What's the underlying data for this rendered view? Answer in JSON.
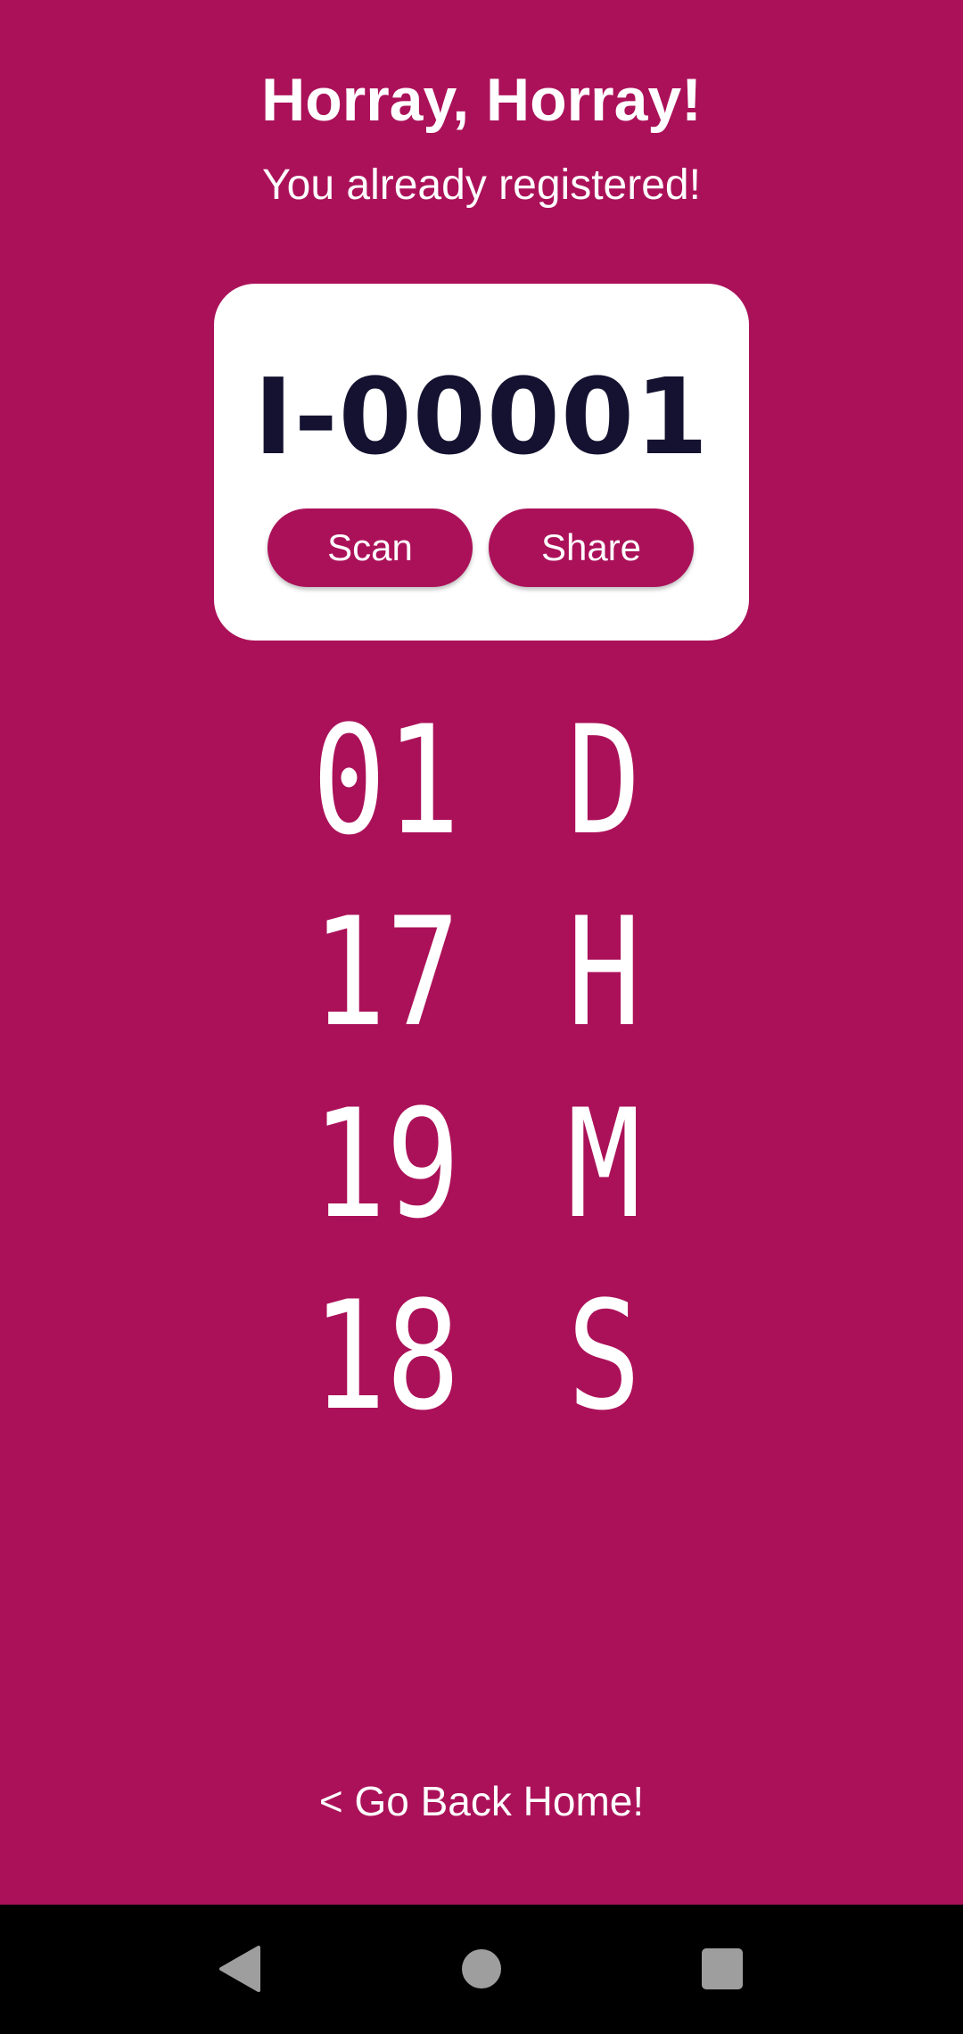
{
  "header": {
    "title": "Horray, Horray!",
    "subtitle": "You already registered!"
  },
  "ticket": {
    "id": "I-00001",
    "scan_label": "Scan",
    "share_label": "Share"
  },
  "countdown": [
    {
      "value": "01",
      "unit": "D"
    },
    {
      "value": "17",
      "unit": "H"
    },
    {
      "value": "19",
      "unit": "M"
    },
    {
      "value": "18",
      "unit": "S"
    }
  ],
  "footer": {
    "home_link": "< Go Back Home!"
  },
  "system_nav": {
    "icons": [
      "back-icon",
      "home-icon",
      "recents-icon"
    ],
    "icon_color": "#9e9e9e"
  },
  "colors": {
    "background": "#ab1159",
    "card": "#ffffff",
    "id_text": "#141230",
    "navbar": "#000000"
  }
}
